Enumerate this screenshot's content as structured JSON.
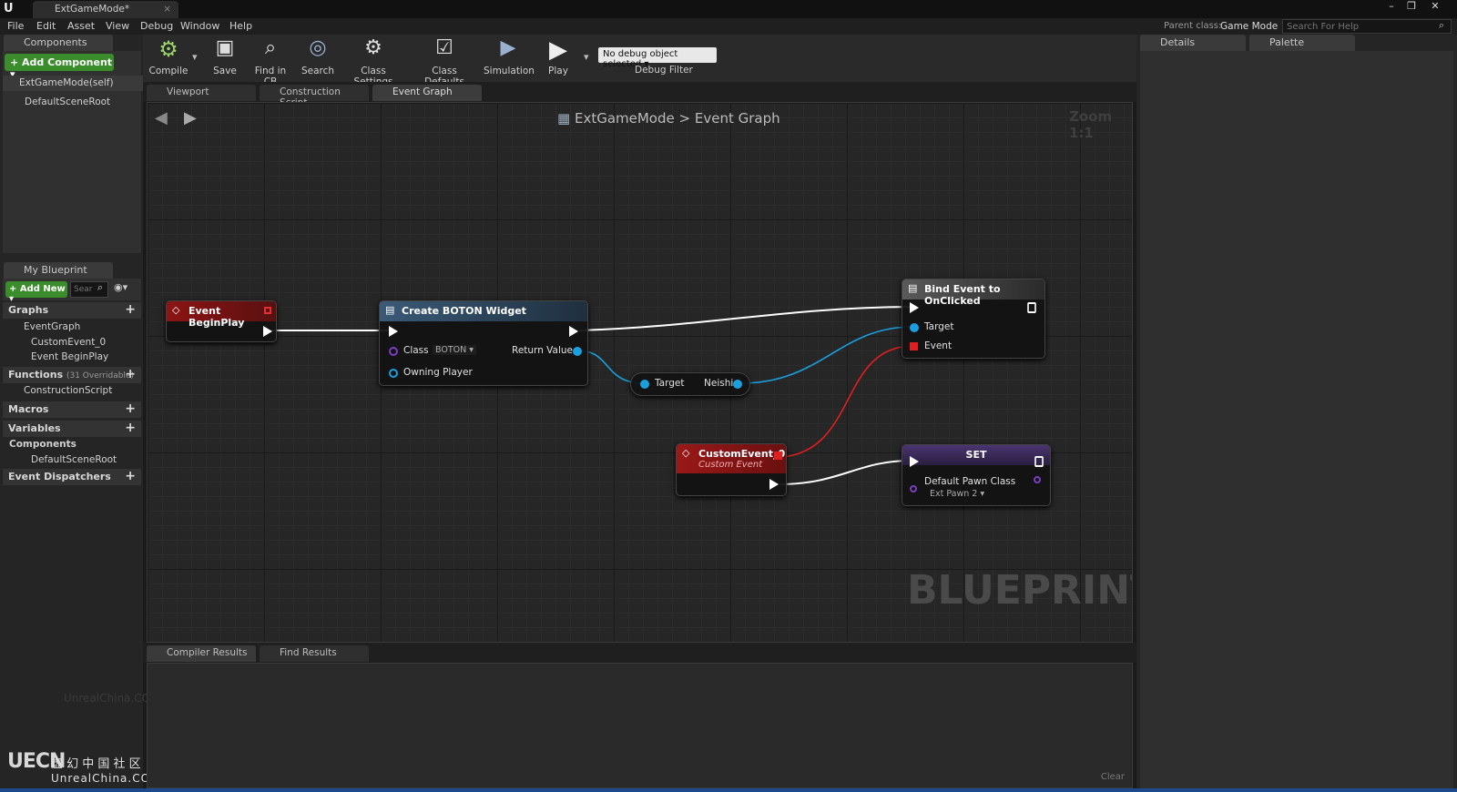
{
  "window": {
    "tab_title": "ExtGameMode*",
    "parent_class_label": "Parent class:",
    "parent_class_value": "Game Mode",
    "search_help_placeholder": "Search For Help"
  },
  "menu": [
    "File",
    "Edit",
    "Asset",
    "View",
    "Debug",
    "Window",
    "Help"
  ],
  "components_panel": {
    "tab": "Components",
    "add_button": "+ Add Component",
    "items": [
      "ExtGameMode(self)",
      "DefaultSceneRoot"
    ]
  },
  "my_blueprint": {
    "tab": "My Blueprint",
    "add_new": "+ Add New",
    "search_placeholder": "Sear",
    "graphs_label": "Graphs",
    "graph_items": [
      "EventGraph",
      "CustomEvent_0",
      "Event BeginPlay"
    ],
    "functions_label": "Functions",
    "functions_count": "(31 Overridable)",
    "function_items": [
      "ConstructionScript"
    ],
    "macros_label": "Macros",
    "variables_label": "Variables",
    "components_label": "Components",
    "component_items": [
      "DefaultSceneRoot"
    ],
    "dispatchers_label": "Event Dispatchers"
  },
  "toolbar": {
    "compile": "Compile",
    "save": "Save",
    "find_in_cb": "Find in CB",
    "search": "Search",
    "class_settings": "Class Settings",
    "class_defaults": "Class Defaults",
    "simulation": "Simulation",
    "play": "Play",
    "debug_select": "No debug object selected",
    "debug_filter": "Debug Filter"
  },
  "doc_tabs": [
    "Viewport",
    "Construction Script",
    "Event Graph"
  ],
  "graph": {
    "breadcrumb_root": "ExtGameMode",
    "breadcrumb_sep": ">",
    "breadcrumb_current": "Event Graph",
    "zoom": "Zoom 1:1",
    "watermark": "BLUEPRINT",
    "nodes": {
      "begin_play": {
        "title": "Event BeginPlay"
      },
      "create_widget": {
        "title": "Create BOTON Widget",
        "class_label": "Class",
        "class_value": "BOTON",
        "return_value": "Return Value",
        "owning_player": "Owning Player"
      },
      "getter": {
        "target": "Target",
        "output": "Neishi"
      },
      "bind_event": {
        "title": "Bind Event to OnClicked",
        "target": "Target",
        "event": "Event"
      },
      "custom_event": {
        "title": "CustomEvent_0",
        "subtitle": "Custom Event"
      },
      "set": {
        "title": "SET",
        "var_label": "Default Pawn Class",
        "var_value": "Ext Pawn 2"
      }
    }
  },
  "right_tabs": [
    "Details",
    "Palette"
  ],
  "bottom_tabs": [
    "Compiler Results",
    "Find Results"
  ],
  "bottom_clear": "Clear",
  "brand": {
    "logo": "UECN",
    "cn_text": "虚 幻 中 国 社 区",
    "site": "UnrealChina.COM",
    "faint": "UnrealChina.COM"
  },
  "colors": {
    "event_red": "#8c1414",
    "func_blue": "#2e4d66",
    "set_purple": "#3b2a5a",
    "exec_white": "#ffffff",
    "object_blue": "#1aa0e0",
    "delegate_red": "#ff3030"
  }
}
